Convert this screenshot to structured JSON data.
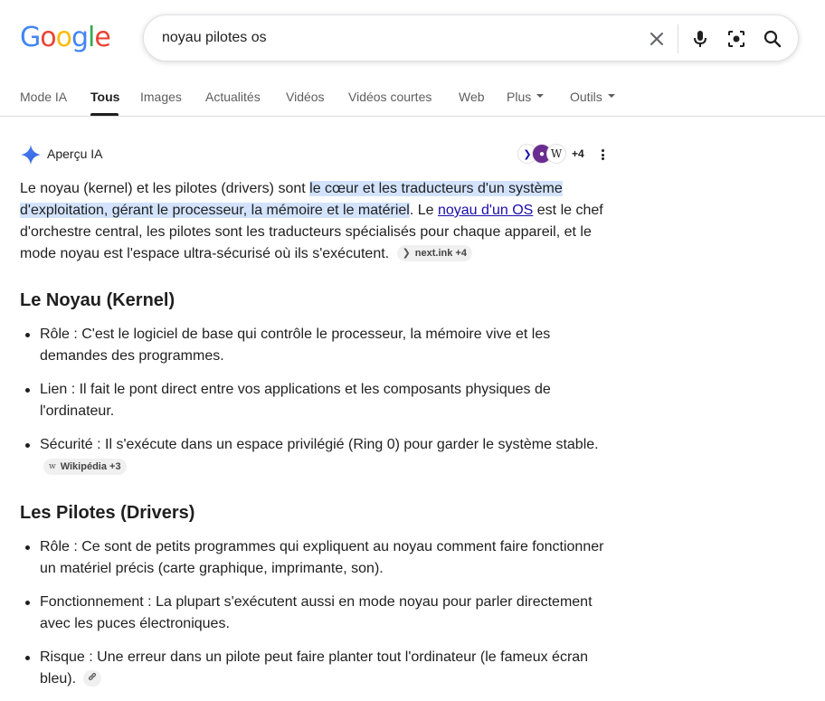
{
  "logo": {
    "letters": [
      "G",
      "o",
      "o",
      "g",
      "l",
      "e"
    ],
    "colors": [
      "#4285F4",
      "#EA4335",
      "#FBBC05",
      "#4285F4",
      "#34A853",
      "#EA4335"
    ]
  },
  "search": {
    "query": "noyau pilotes os"
  },
  "tabs": [
    {
      "label": "Mode IA"
    },
    {
      "label": "Tous"
    },
    {
      "label": "Images"
    },
    {
      "label": "Actualités"
    },
    {
      "label": "Vidéos"
    },
    {
      "label": "Vidéos courtes"
    },
    {
      "label": "Web"
    },
    {
      "label": "Plus"
    },
    {
      "label": "Outils"
    }
  ],
  "overview": {
    "title": "Aperçu IA",
    "sources_count": "+4",
    "intro": {
      "part1": "Le noyau (kernel) et les pilotes (drivers) sont ",
      "highlight": "le cœur et les traducteurs d'un système d'exploitation, gérant le processeur, la mémoire et le matériel",
      "part2": ". Le ",
      "link": "noyau d'un OS",
      "part3": " est le chef d'orchestre central, les pilotes sont les traducteurs spécialisés pour chaque appareil, et le mode noyau est l'espace ultra-sécurisé où ils s'exécutent.",
      "chip": "next.ink +4"
    },
    "section1": {
      "heading": "Le Noyau (Kernel)",
      "items": [
        "Rôle : C'est le logiciel de base qui contrôle le processeur, la mémoire vive et les demandes des programmes.",
        "Lien : Il fait le pont direct entre vos applications et les composants physiques de l'ordinateur.",
        "Sécurité : Il s'exécute dans un espace privilégié (Ring 0) pour garder le système stable."
      ],
      "chip": "Wikipédia +3"
    },
    "section2": {
      "heading": "Les Pilotes (Drivers)",
      "items": [
        "Rôle : Ce sont de petits programmes qui expliquent au noyau comment faire fonctionner un matériel précis (carte graphique, imprimante, son).",
        "Fonctionnement : La plupart s'exécutent aussi en mode noyau pour parler directement avec les puces électroniques.",
        "Risque : Une erreur dans un pilote peut faire planter tout l'ordinateur (le fameux écran bleu)."
      ]
    }
  },
  "icons": [
    "close-icon",
    "microphone-icon",
    "lens-icon",
    "search-icon",
    "sparkle-icon",
    "link-icon",
    "more-vert-icon"
  ]
}
